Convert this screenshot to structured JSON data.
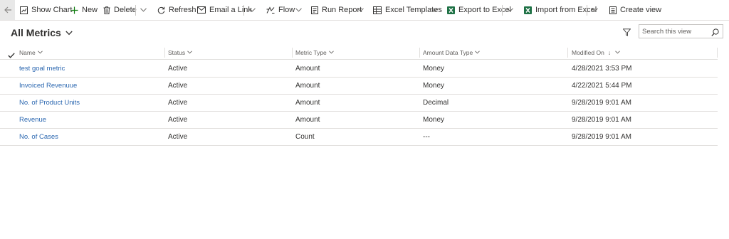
{
  "toolbar": {
    "show_chart": "Show Chart",
    "new": "New",
    "delete": "Delete",
    "refresh": "Refresh",
    "email_link": "Email a Link",
    "flow": "Flow",
    "run_report": "Run Report",
    "excel_templates": "Excel Templates",
    "export_excel": "Export to Excel",
    "import_excel": "Import from Excel",
    "create_view": "Create view"
  },
  "view": {
    "title": "All Metrics"
  },
  "search": {
    "placeholder": "Search this view"
  },
  "grid": {
    "columns": [
      "Name",
      "Status",
      "Metric Type",
      "Amount Data Type",
      "Modified On"
    ],
    "sort_indicator": "↓",
    "rows": [
      {
        "name": "test goal metric",
        "status": "Active",
        "metric_type": "Amount",
        "amount_data_type": "Money",
        "modified_on": "4/28/2021 3:53 PM"
      },
      {
        "name": "Invoiced Revenuue",
        "status": "Active",
        "metric_type": "Amount",
        "amount_data_type": "Money",
        "modified_on": "4/22/2021 5:44 PM"
      },
      {
        "name": "No. of Product Units",
        "status": "Active",
        "metric_type": "Amount",
        "amount_data_type": "Decimal",
        "modified_on": "9/28/2019 9:01 AM"
      },
      {
        "name": "Revenue",
        "status": "Active",
        "metric_type": "Amount",
        "amount_data_type": "Money",
        "modified_on": "9/28/2019 9:01 AM"
      },
      {
        "name": "No. of Cases",
        "status": "Active",
        "metric_type": "Count",
        "amount_data_type": "---",
        "modified_on": "9/28/2019 9:01 AM"
      }
    ]
  },
  "colors": {
    "link": "#2b67b0",
    "excel_green": "#1e7145",
    "border": "#e1dfdd"
  },
  "icons": [
    "back-arrow-icon",
    "chart-icon",
    "plus-icon",
    "trash-icon",
    "refresh-icon",
    "email-icon",
    "flow-icon",
    "report-icon",
    "excel-template-icon",
    "excel-export-icon",
    "excel-import-icon",
    "create-view-icon",
    "chevron-down-icon",
    "filter-icon",
    "search-icon",
    "checkmark-icon"
  ]
}
